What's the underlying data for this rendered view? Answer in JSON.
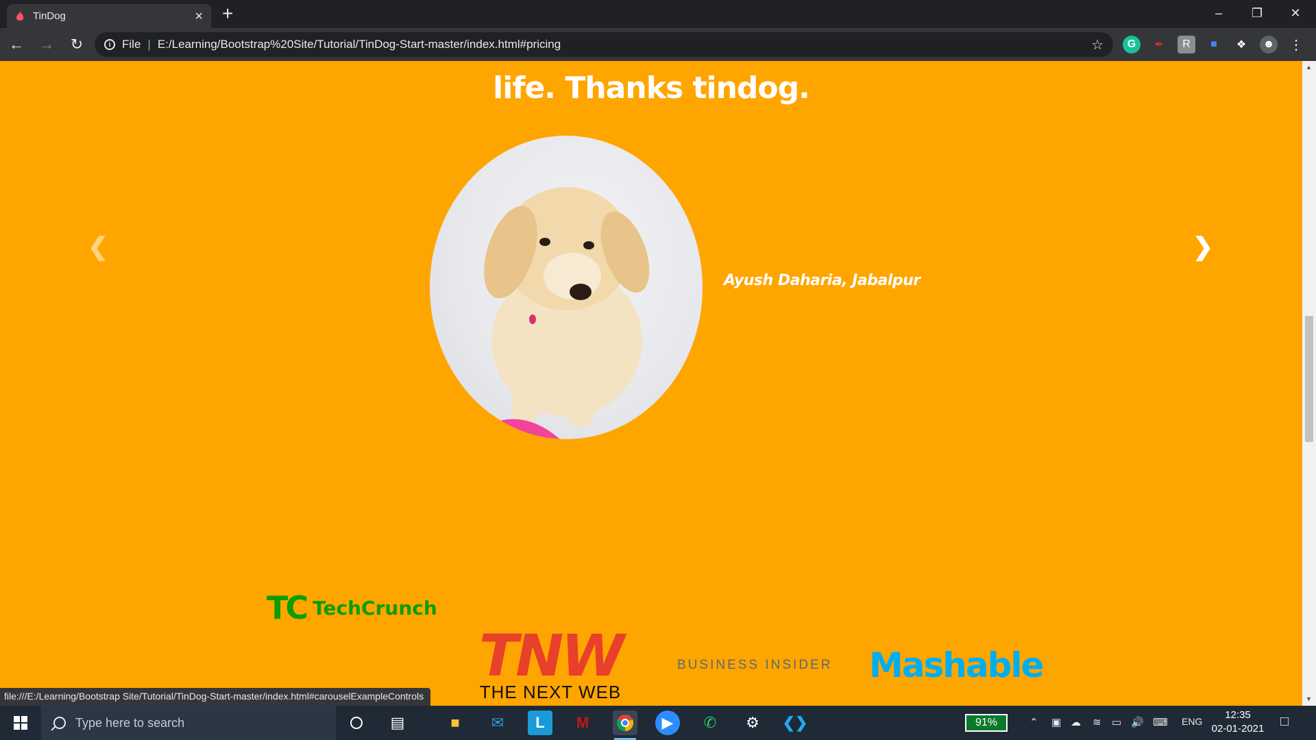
{
  "browser": {
    "tab_title": "TinDog",
    "tab_close": "×",
    "new_tab": "+",
    "omnibox_scheme": "File",
    "omnibox_url": "E:/Learning/Bootstrap%20Site/Tutorial/TinDog-Start-master/index.html#pricing",
    "status_url": "file:///E:/Learning/Bootstrap Site/Tutorial/TinDog-Start-master/index.html#carouselExampleControls"
  },
  "testimonial": {
    "quote_tail": "life. Thanks tindog.",
    "author": "Ayush Daharia, Jabalpur"
  },
  "press": {
    "techcrunch_mark": "TC",
    "techcrunch": "TechCrunch",
    "tnw_big": "TNW",
    "tnw_small": "THE NEXT WEB",
    "business_insider": "BUSINESS INSIDER",
    "mashable": "Mashable"
  },
  "taskbar": {
    "search_placeholder": "Type here to search",
    "battery": "91%",
    "language": "ENG",
    "time": "12:35",
    "date": "02-01-2021"
  },
  "colors": {
    "page_bg": "#ffa500",
    "techcrunch": "#0a9e01",
    "tnw": "#e8402a",
    "mashable": "#00aeef"
  }
}
